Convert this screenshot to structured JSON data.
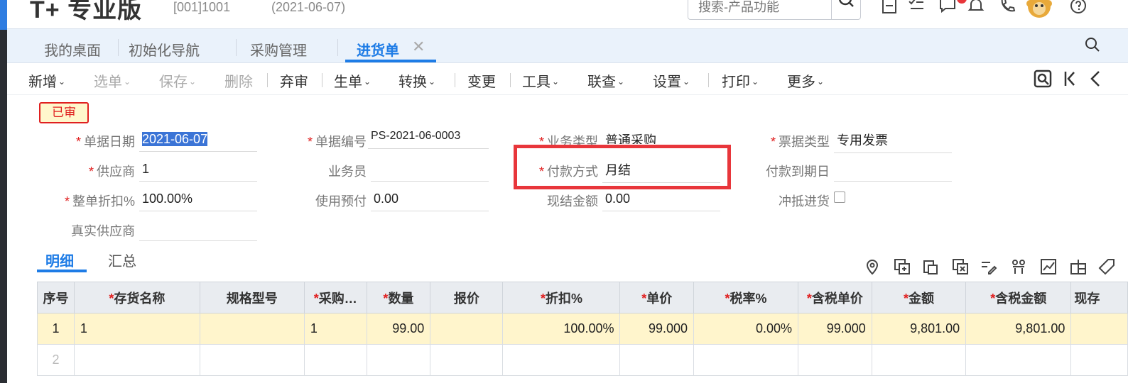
{
  "header": {
    "brand": "T+ 专业版",
    "account": "[001]1001",
    "date": "(2021-06-07)",
    "search_placeholder": "搜索-产品功能",
    "icons": [
      "search-icon",
      "save-icon",
      "checklist-icon",
      "message-icon",
      "bell-icon",
      "phone-icon",
      "avatar-icon",
      "help-icon"
    ]
  },
  "tabs": [
    {
      "label": "我的桌面"
    },
    {
      "label": "初始化导航"
    },
    {
      "label": "采购管理"
    },
    {
      "label": "进货单",
      "active": true,
      "close": "✕"
    }
  ],
  "toolbar": {
    "items": [
      {
        "label": "新增",
        "caret": "⌄",
        "disabled": false
      },
      {
        "label": "选单",
        "caret": "⌄",
        "disabled": true
      },
      {
        "label": "保存",
        "caret": "⌄",
        "disabled": true
      },
      {
        "label": "删除",
        "disabled": true
      },
      {
        "label": "弃审"
      },
      {
        "label": "生单",
        "caret": "⌄"
      },
      {
        "label": "转换",
        "caret": "⌄"
      },
      {
        "label": "变更"
      },
      {
        "label": "工具",
        "caret": "⌄"
      },
      {
        "label": "联查",
        "caret": "⌄"
      },
      {
        "label": "设置",
        "caret": "⌄"
      },
      {
        "label": "打印",
        "caret": "⌄"
      },
      {
        "label": "更多",
        "caret": "⌄"
      }
    ],
    "right_icons": [
      "preview-icon",
      "first-record-icon",
      "previous-record-icon"
    ]
  },
  "status_badge": "已审",
  "form": {
    "doc_date": {
      "label": "单据日期",
      "value": "2021-06-07",
      "required": true
    },
    "doc_no": {
      "label": "单据编号",
      "value": "PS-2021-06-0003",
      "required": true
    },
    "biz_type": {
      "label": "业务类型",
      "value": "普通采购",
      "required": true
    },
    "invoice_type": {
      "label": "票据类型",
      "value": "专用发票",
      "required": true
    },
    "supplier": {
      "label": "供应商",
      "value": "1",
      "required": true
    },
    "salesman": {
      "label": "业务员",
      "value": ""
    },
    "payment_method": {
      "label": "付款方式",
      "value": "月结",
      "required": true
    },
    "due_date": {
      "label": "付款到期日",
      "value": ""
    },
    "discount": {
      "label": "整单折扣%",
      "value": "100.00%",
      "required": true
    },
    "prepay": {
      "label": "使用预付",
      "value": "0.00"
    },
    "cash_amount": {
      "label": "现结金额",
      "value": "0.00"
    },
    "offset": {
      "label": "冲抵进货"
    },
    "real_supplier": {
      "label": "真实供应商",
      "value": ""
    }
  },
  "detail_tabs": [
    "明细",
    "汇总"
  ],
  "grid_icons": [
    "location-icon",
    "copy-row-icon",
    "paste-row-icon",
    "delete-row-icon",
    "edit-icon",
    "barcode-icon",
    "trend-icon",
    "columns-icon",
    "tag-icon"
  ],
  "table": {
    "columns": [
      {
        "label": "序号",
        "required": false
      },
      {
        "label": "存货名称",
        "required": true
      },
      {
        "label": "规格型号",
        "required": false
      },
      {
        "label": "采购…",
        "required": true
      },
      {
        "label": "数量",
        "required": true
      },
      {
        "label": "报价",
        "required": false
      },
      {
        "label": "折扣%",
        "required": true
      },
      {
        "label": "单价",
        "required": true
      },
      {
        "label": "税率%",
        "required": true
      },
      {
        "label": "含税单价",
        "required": true
      },
      {
        "label": "金额",
        "required": true
      },
      {
        "label": "含税金额",
        "required": true
      },
      {
        "label": "现存",
        "required": false
      }
    ],
    "rows": [
      [
        "1",
        "1",
        "",
        "1",
        "99.00",
        "",
        "100.00%",
        "99.000",
        "0.00%",
        "99.000",
        "9,801.00",
        "9,801.00",
        ""
      ],
      [
        "2",
        "",
        "",
        "",
        "",
        "",
        "",
        "",
        "",
        "",
        "",
        "",
        ""
      ]
    ]
  },
  "colors": {
    "accent": "#1e7ce6",
    "highlight": "#e8363b",
    "selected_row": "#fff5cc"
  }
}
